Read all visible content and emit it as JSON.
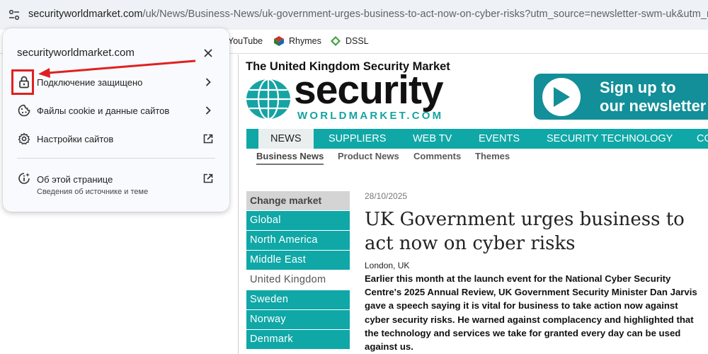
{
  "browser": {
    "url_host": "securityworldmarket.com",
    "url_path": "/uk/News/Business-News/uk-government-urges-business-to-act-now-on-cyber-risks?utm_source=newsletter-swm-uk&utm_medium",
    "bookmarks": [
      {
        "label": "YouTube",
        "icon": "youtube-icon"
      },
      {
        "label": "Rhymes",
        "icon": "rhymes-icon"
      },
      {
        "label": "DSSL",
        "icon": "dssl-icon"
      }
    ]
  },
  "popup": {
    "domain": "securityworldmarket.com",
    "rows": [
      {
        "label": "Подключение защищено",
        "icon": "lock-icon"
      },
      {
        "label": "Файлы cookie и данные сайтов",
        "icon": "cookie-icon"
      },
      {
        "label": "Настройки сайтов",
        "icon": "gear-icon"
      }
    ],
    "about_title": "Об этой странице",
    "about_subtitle": "Сведения об источнике и теме",
    "highlight_color": "#e02020"
  },
  "site": {
    "tagline": "The United Kingdom Security Market",
    "logo_word": "security",
    "logo_sub": "WORLDMARKET.COM",
    "signup_line1": "Sign up to",
    "signup_line2": "our newsletter",
    "nav": [
      "NEWS",
      "SUPPLIERS",
      "WEB TV",
      "EVENTS",
      "SECURITY TECHNOLOGY",
      "CO"
    ],
    "subnav": [
      "Business News",
      "Product News",
      "Comments",
      "Themes"
    ],
    "market_heading": "Change market",
    "markets": [
      "Global",
      "North America",
      "Middle East",
      "United Kingdom",
      "Sweden",
      "Norway",
      "Denmark"
    ],
    "accent_color": "#10a7a7"
  },
  "article": {
    "date": "28/10/2025",
    "headline": "UK Government urges business to act now on cyber risks",
    "dateline": "London, UK",
    "body": "Earlier this month at the launch event for the National Cyber Security Centre's 2025 Annual Review, UK Government Security Minister Dan Jarvis gave a speech saying it is vital for business to take action now against cyber security risks.  He warned against complacency and highlighted that the technology and services we take for granted every day can be used against us."
  }
}
